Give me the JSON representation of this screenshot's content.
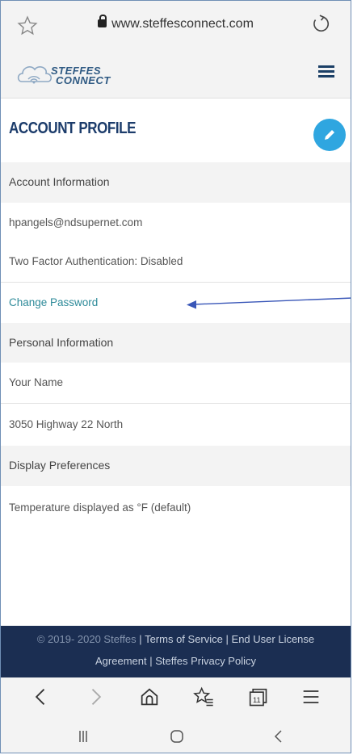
{
  "browser": {
    "url": "www.steffesconnect.com"
  },
  "header": {
    "logo_line1": "STEFFES",
    "logo_line2": "CONNECT",
    "menu_icon": "hamburger-icon"
  },
  "page": {
    "title": "ACCOUNT PROFILE",
    "edit_icon": "pencil-icon"
  },
  "account": {
    "section_label": "Account Information",
    "email": "hpangels@ndsupernet.com",
    "two_factor": "Two Factor Authentication: Disabled",
    "change_password": "Change Password"
  },
  "personal": {
    "section_label": "Personal Information",
    "name": "Your Name",
    "address": "3050 Highway 22 North"
  },
  "display": {
    "section_label": "Display Preferences",
    "temperature": "Temperature displayed as °F (default)"
  },
  "footer": {
    "copyright": "© 2019- 2020 Steffes",
    "sep": "|",
    "terms": "Terms of Service",
    "eula_part1": "End User License",
    "eula_part2": "Agreement",
    "privacy": "Steffes Privacy Policy"
  },
  "colors": {
    "accent": "#2fa6e0",
    "brand_dark": "#1c3c6b",
    "link": "#2d8a99",
    "footer_bg": "#1b2e52"
  }
}
